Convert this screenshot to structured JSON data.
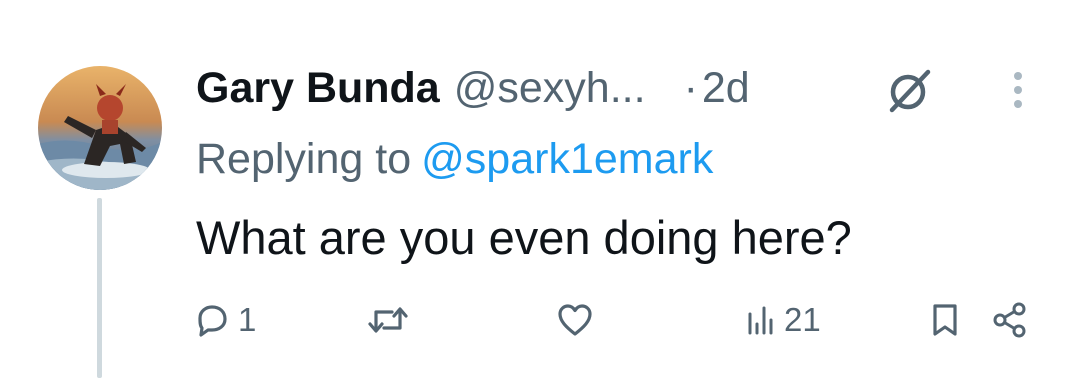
{
  "tweet": {
    "display_name": "Gary Bunda",
    "handle": "@sexyh...",
    "dot": "·",
    "time": "2d",
    "replying_prefix": "Replying to",
    "replying_to": "@spark1emark",
    "text": "What are you even doing here?",
    "avatar_icon": "avatar-surfer-devil",
    "more_icon": "more-vertical-icon",
    "grok_icon": "grok-icon"
  },
  "actions": {
    "reply": {
      "icon": "reply-icon",
      "count": "1"
    },
    "retweet": {
      "icon": "retweet-icon",
      "count": ""
    },
    "like": {
      "icon": "heart-icon",
      "count": ""
    },
    "views": {
      "icon": "views-icon",
      "count": "21"
    },
    "bookmark": {
      "icon": "bookmark-icon",
      "count": ""
    },
    "share": {
      "icon": "share-icon",
      "count": ""
    }
  },
  "colors": {
    "text_primary": "#0f1419",
    "text_secondary": "#536471",
    "accent": "#1d9bf0",
    "thread_line": "#cfd9de"
  }
}
